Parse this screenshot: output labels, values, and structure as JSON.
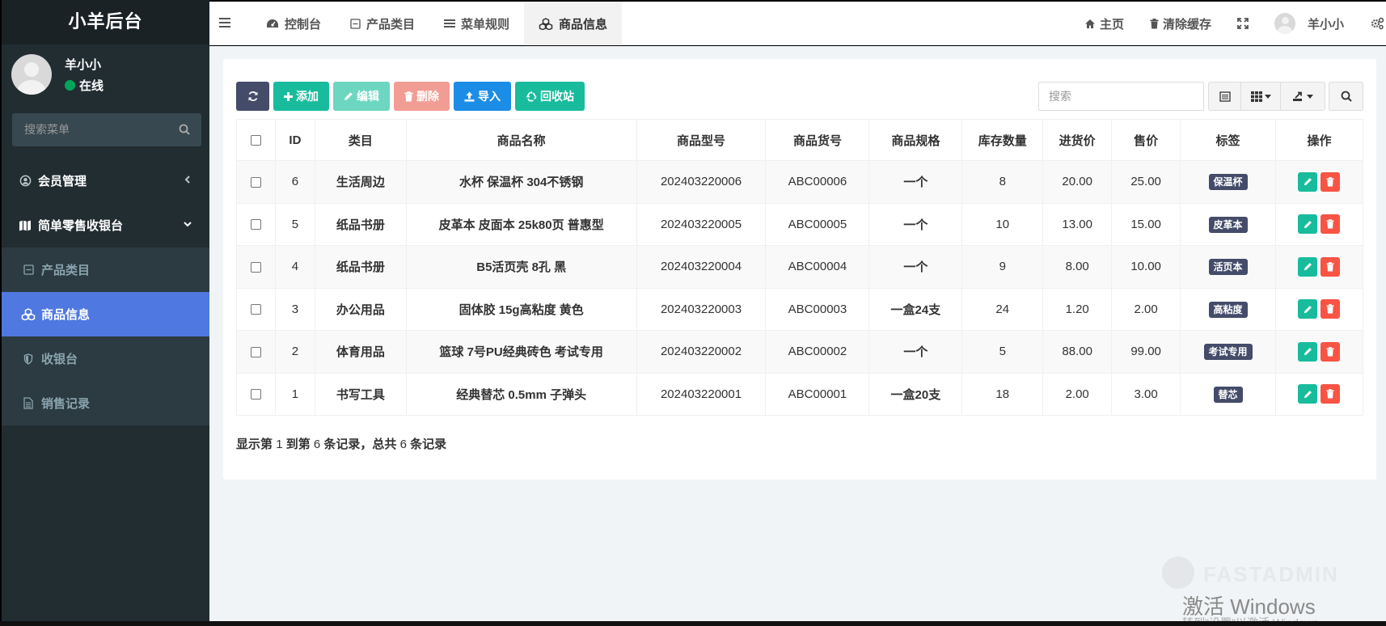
{
  "brand": "小羊后台",
  "user": {
    "name": "羊小小",
    "status": "在线"
  },
  "sidebar": {
    "search_placeholder": "搜索菜单",
    "items": [
      {
        "label": "会员管理",
        "icon": "user-circle-icon"
      },
      {
        "label": "简单零售收银台",
        "icon": "map-icon"
      },
      {
        "label": "产品类目",
        "icon": "minus-square-icon"
      },
      {
        "label": "商品信息",
        "icon": "cubes-icon",
        "active": true
      },
      {
        "label": "收银台",
        "icon": "shield-icon"
      },
      {
        "label": "销售记录",
        "icon": "file-text-icon"
      }
    ]
  },
  "navbar": {
    "tabs": [
      {
        "label": "控制台",
        "icon": "dashboard-icon"
      },
      {
        "label": "产品类目",
        "icon": "minus-square-icon"
      },
      {
        "label": "菜单规则",
        "icon": "bars-icon"
      },
      {
        "label": "商品信息",
        "icon": "cubes-icon",
        "active": true
      }
    ],
    "home": "主页",
    "clear_cache": "清除缓存",
    "user": "羊小小"
  },
  "toolbar": {
    "add": "添加",
    "edit": "编辑",
    "delete": "删除",
    "import": "导入",
    "recycle": "回收站",
    "search_placeholder": "搜索"
  },
  "table": {
    "headers": [
      "ID",
      "类目",
      "商品名称",
      "商品型号",
      "商品货号",
      "商品规格",
      "库存数量",
      "进货价",
      "售价",
      "标签",
      "操作"
    ],
    "rows": [
      [
        "6",
        "生活周边",
        "水杯 保温杯 304不锈钢",
        "202403220006",
        "ABC00006",
        "一个",
        "8",
        "20.00",
        "25.00",
        "保温杯"
      ],
      [
        "5",
        "纸品书册",
        "皮革本 皮面本 25k80页 普惠型",
        "202403220005",
        "ABC00005",
        "一个",
        "10",
        "13.00",
        "15.00",
        "皮革本"
      ],
      [
        "4",
        "纸品书册",
        "B5活页壳 8孔 黑",
        "202403220004",
        "ABC00004",
        "一个",
        "9",
        "8.00",
        "10.00",
        "活页本"
      ],
      [
        "3",
        "办公用品",
        "固体胶 15g高粘度 黄色",
        "202403220003",
        "ABC00003",
        "一盒24支",
        "24",
        "1.20",
        "2.00",
        "高粘度"
      ],
      [
        "2",
        "体育用品",
        "篮球 7号PU经典砖色 考试专用",
        "202403220002",
        "ABC00002",
        "一个",
        "5",
        "88.00",
        "99.00",
        "考试专用"
      ],
      [
        "1",
        "书写工具",
        "经典替芯 0.5mm 子弹头",
        "202403220001",
        "ABC00001",
        "一盒20支",
        "18",
        "2.00",
        "3.00",
        "替芯"
      ]
    ]
  },
  "pager": {
    "p1": "显示第",
    "from": "1",
    "p2": "到第",
    "to": "6",
    "p3": "条记录，总共",
    "total": "6",
    "p4": "条记录"
  },
  "watermark": {
    "brand": "FASTADMIN",
    "activate": "激活 Windows",
    "sub": "转到\"设置\"以激活 Windows"
  },
  "colors": {
    "sidebar": "#222d32",
    "active": "#4f78e0",
    "green": "#18bc9c",
    "red": "#f75444",
    "blue": "#1c8de6",
    "tag": "#444c69"
  }
}
